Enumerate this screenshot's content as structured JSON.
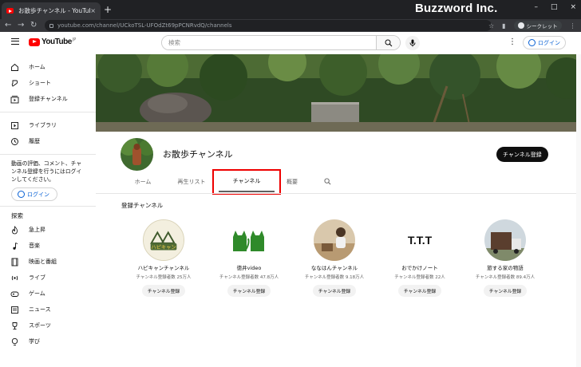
{
  "browser": {
    "tab_title": "お散歩チャンネル - YouTube",
    "tab_close": "×",
    "new_tab": "+",
    "brand_overlay": "Buzzword Inc.",
    "window_controls": [
      "–",
      "□",
      "×"
    ],
    "url": "youtube.com/channel/UCkoTSL-UFOdZt69pPCNRvdQ/channels",
    "incognito_label": "シークレット"
  },
  "header": {
    "logo_text": "YouTube",
    "logo_region": "JP",
    "search_placeholder": "検索",
    "login_label": "ログイン"
  },
  "sidebar": {
    "main_items": [
      {
        "label": "ホーム",
        "icon": "home-icon"
      },
      {
        "label": "ショート",
        "icon": "shorts-icon"
      },
      {
        "label": "登録チャンネル",
        "icon": "subscriptions-icon"
      }
    ],
    "library_items": [
      {
        "label": "ライブラリ",
        "icon": "library-icon"
      },
      {
        "label": "履歴",
        "icon": "history-icon"
      }
    ],
    "login_prompt": "動画の評価、コメント、チャンネル登録を行うにはログインしてください。",
    "login_label": "ログイン",
    "explore_title": "探索",
    "explore_items": [
      {
        "label": "急上昇",
        "icon": "trending-icon"
      },
      {
        "label": "音楽",
        "icon": "music-icon"
      },
      {
        "label": "映画と番組",
        "icon": "movies-icon"
      },
      {
        "label": "ライブ",
        "icon": "live-icon"
      },
      {
        "label": "ゲーム",
        "icon": "gaming-icon"
      },
      {
        "label": "ニュース",
        "icon": "news-icon"
      },
      {
        "label": "スポーツ",
        "icon": "sports-icon"
      },
      {
        "label": "学び",
        "icon": "learning-icon"
      }
    ]
  },
  "channel": {
    "name": "お散歩チャンネル",
    "subscribe_label": "チャンネル登録",
    "tabs": [
      "ホーム",
      "再生リスト",
      "チャンネル",
      "概要"
    ],
    "active_tab": "チャンネル",
    "section_title": "登録チャンネル",
    "subscriptions": [
      {
        "name": "ハピキャンチャンネル",
        "count": "チャンネル登録者数 25万人",
        "button": "チャンネル登録",
        "avatar_text": "ハピキャン"
      },
      {
        "name": "徳井video",
        "count": "チャンネル登録者数 47.8万人",
        "button": "チャンネル登録"
      },
      {
        "name": "ななはんチャンネル",
        "count": "チャンネル登録者数 9.18万人",
        "button": "チャンネル登録"
      },
      {
        "name": "おでかけノート",
        "count": "チャンネル登録者数 22人",
        "button": "チャンネル登録",
        "avatar_text": "T.T.T"
      },
      {
        "name": "旅する家の物語",
        "count": "チャンネル登録者数 89.4万人",
        "button": "チャンネル登録"
      }
    ]
  },
  "colors": {
    "accent_blue": "#065fd4",
    "youtube_red": "#ff0000",
    "highlight_red": "#e00000"
  }
}
